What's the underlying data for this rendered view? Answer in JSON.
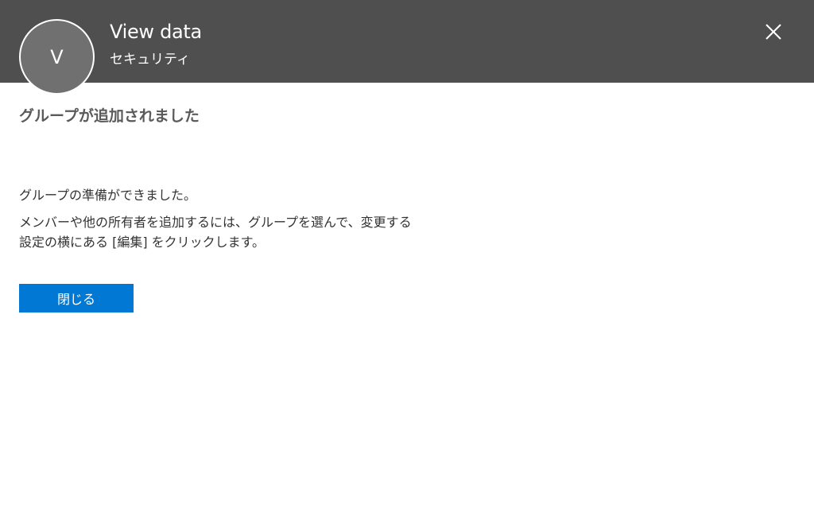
{
  "header": {
    "avatar_initial": "V",
    "title": "View data",
    "subtitle": "セキュリティ",
    "close_icon": "close-icon",
    "background_color": "#4f4f4f"
  },
  "main": {
    "heading": "グループが追加されました",
    "ready_text": "グループの準備ができました。",
    "instruction_line1": "メンバーや他の所有者を追加するには、グループを選んで、変更する",
    "instruction_line2": "設定の横にある [編集] をクリックします。",
    "close_button_label": "閉じる",
    "accent_color": "#0078d4"
  }
}
